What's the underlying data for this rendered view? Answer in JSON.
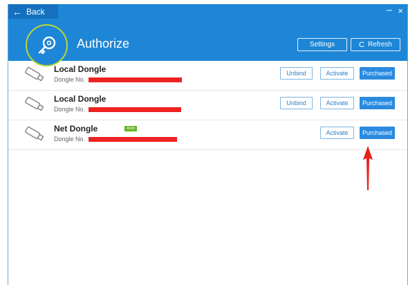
{
  "header": {
    "back_label": "Back",
    "title": "Authorize",
    "minimize_label": "–",
    "close_label": "×",
    "settings_label": "Settings",
    "refresh_label": "Refresh",
    "refresh_icon": "C"
  },
  "colors": {
    "header_bg": "#1e86d6",
    "accent_ring": "#b8d833",
    "primary_button": "#2a8ae0",
    "redaction": "#ee2222",
    "tag_green": "#63b520"
  },
  "dongles": [
    {
      "name": "Local Dongle",
      "number_label": "Dongle No.",
      "unbind_label": "Unbind",
      "activate_label": "Activate",
      "purchased_label": "Purchased"
    },
    {
      "name": "Local Dongle",
      "number_label": "Dongle No.",
      "unbind_label": "Unbind",
      "activate_label": "Activate",
      "purchased_label": "Purchased"
    },
    {
      "name": "Net Dongle",
      "number_label": "Dongle No.",
      "tag": "Aton",
      "activate_label": "Activate",
      "purchased_label": "Purchased"
    }
  ],
  "icons": {
    "logo": "key-icon",
    "dongle": "usb-dongle-icon",
    "annotation": "red-arrow-icon"
  }
}
